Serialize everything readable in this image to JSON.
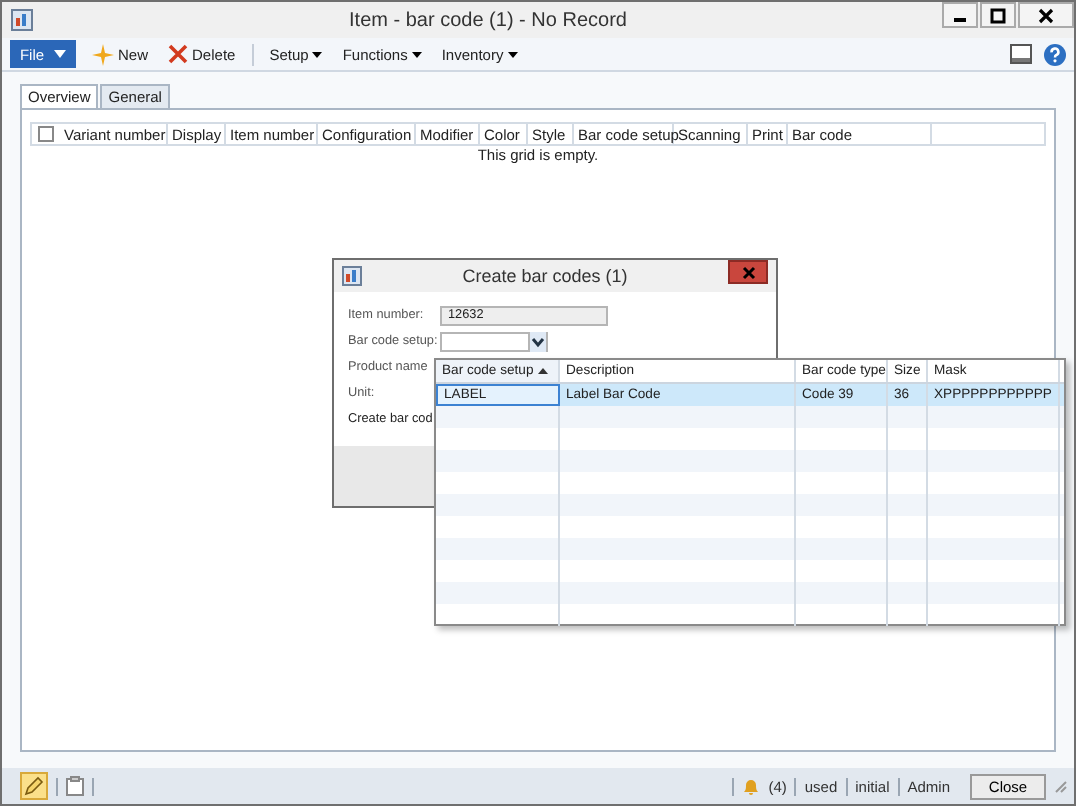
{
  "window": {
    "title": "Item - bar code (1) - No Record"
  },
  "toolbar": {
    "file_button": "File",
    "items": [
      {
        "kind": "new",
        "label": "New"
      },
      {
        "kind": "delete",
        "label": "Delete"
      },
      {
        "kind": "menu",
        "label": "Setup"
      },
      {
        "kind": "menu",
        "label": "Functions"
      },
      {
        "kind": "menu",
        "label": "Inventory"
      }
    ]
  },
  "tabs": [
    {
      "label": "Overview",
      "selected": true
    },
    {
      "label": "General",
      "selected": false
    }
  ],
  "grid": {
    "select_all_checked": false,
    "columns": [
      "Variant number",
      "Display",
      "Item number",
      "Configuration",
      "Modifier",
      "Color",
      "Style",
      "Bar code setup",
      "Scanning",
      "Print",
      "Bar code"
    ],
    "empty_message": "This grid is empty."
  },
  "dialog": {
    "title": "Create bar codes (1)",
    "fields": [
      {
        "kind": "text",
        "label": "Item number:",
        "value": "12632"
      },
      {
        "kind": "combo",
        "label": "Bar code setup:"
      },
      {
        "kind": "label",
        "label": "Product name"
      },
      {
        "kind": "label",
        "label": "Unit:"
      },
      {
        "kind": "plain",
        "label": "Create bar cod"
      }
    ]
  },
  "dropdown": {
    "columns": [
      {
        "label": "Bar code setup",
        "sorted_ascending": true
      },
      {
        "label": "Description",
        "sorted_ascending": false
      },
      {
        "label": "Bar code type",
        "sorted_ascending": false
      },
      {
        "label": "Size",
        "sorted_ascending": false
      },
      {
        "label": "Mask",
        "sorted_ascending": false
      }
    ],
    "rows": [
      {
        "cells": [
          "LABEL",
          "Label Bar Code",
          "Code 39",
          "36",
          "XPPPPPPPPPPPP"
        ],
        "selected": true
      }
    ]
  },
  "status_bar": {
    "edit_mode_on": true,
    "notifications": "(4)",
    "items": [
      "used",
      "initial",
      "Admin"
    ],
    "close_button": "Close"
  }
}
